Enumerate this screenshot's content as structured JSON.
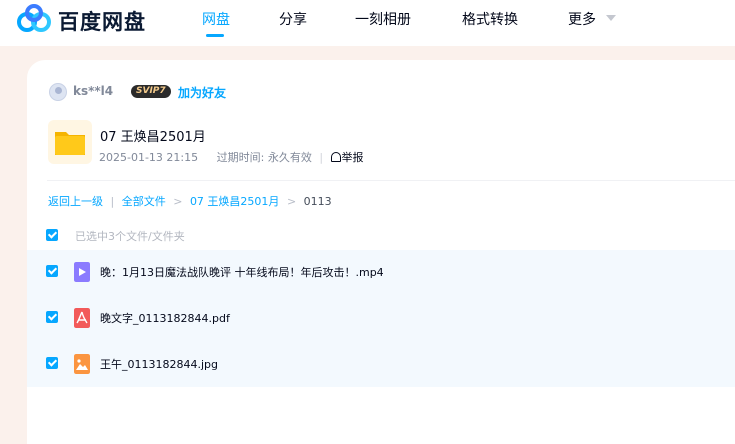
{
  "brand": {
    "name": "百度网盘"
  },
  "nav": {
    "items": [
      {
        "label": "网盘",
        "active": true
      },
      {
        "label": "分享",
        "active": false
      },
      {
        "label": "一刻相册",
        "active": false
      },
      {
        "label": "格式转换",
        "active": false
      },
      {
        "label": "更多",
        "active": false
      }
    ]
  },
  "share": {
    "user": {
      "name": "ks**l4",
      "vip_badge": "SVIP7",
      "add_friend": "加为好友"
    },
    "folder": {
      "title": "07 王焕昌2501月",
      "date": "2025-01-13 21:15",
      "expire_label": "过期时间: 永久有效",
      "report": "举报"
    }
  },
  "breadcrumb": {
    "back": "返回上一级",
    "items": [
      "全部文件",
      "07 王焕昌2501月"
    ],
    "current": "0113"
  },
  "selection": {
    "text": "已选中3个文件/文件夹"
  },
  "files": [
    {
      "name": "晚：1月13日魔法战队晚评 十年线布局！年后攻击！.mp4",
      "type": "video-icon",
      "color": "#7c6dff"
    },
    {
      "name": "晚文字_0113182844.pdf",
      "type": "pdf-icon",
      "color": "#f25a5a"
    },
    {
      "name": "王午_0113182844.jpg",
      "type": "image-icon",
      "color": "#f98f3e"
    }
  ],
  "colors": {
    "accent": "#06a7ff",
    "background": "#fbf1ec",
    "row_selected": "#f3f9fe"
  }
}
